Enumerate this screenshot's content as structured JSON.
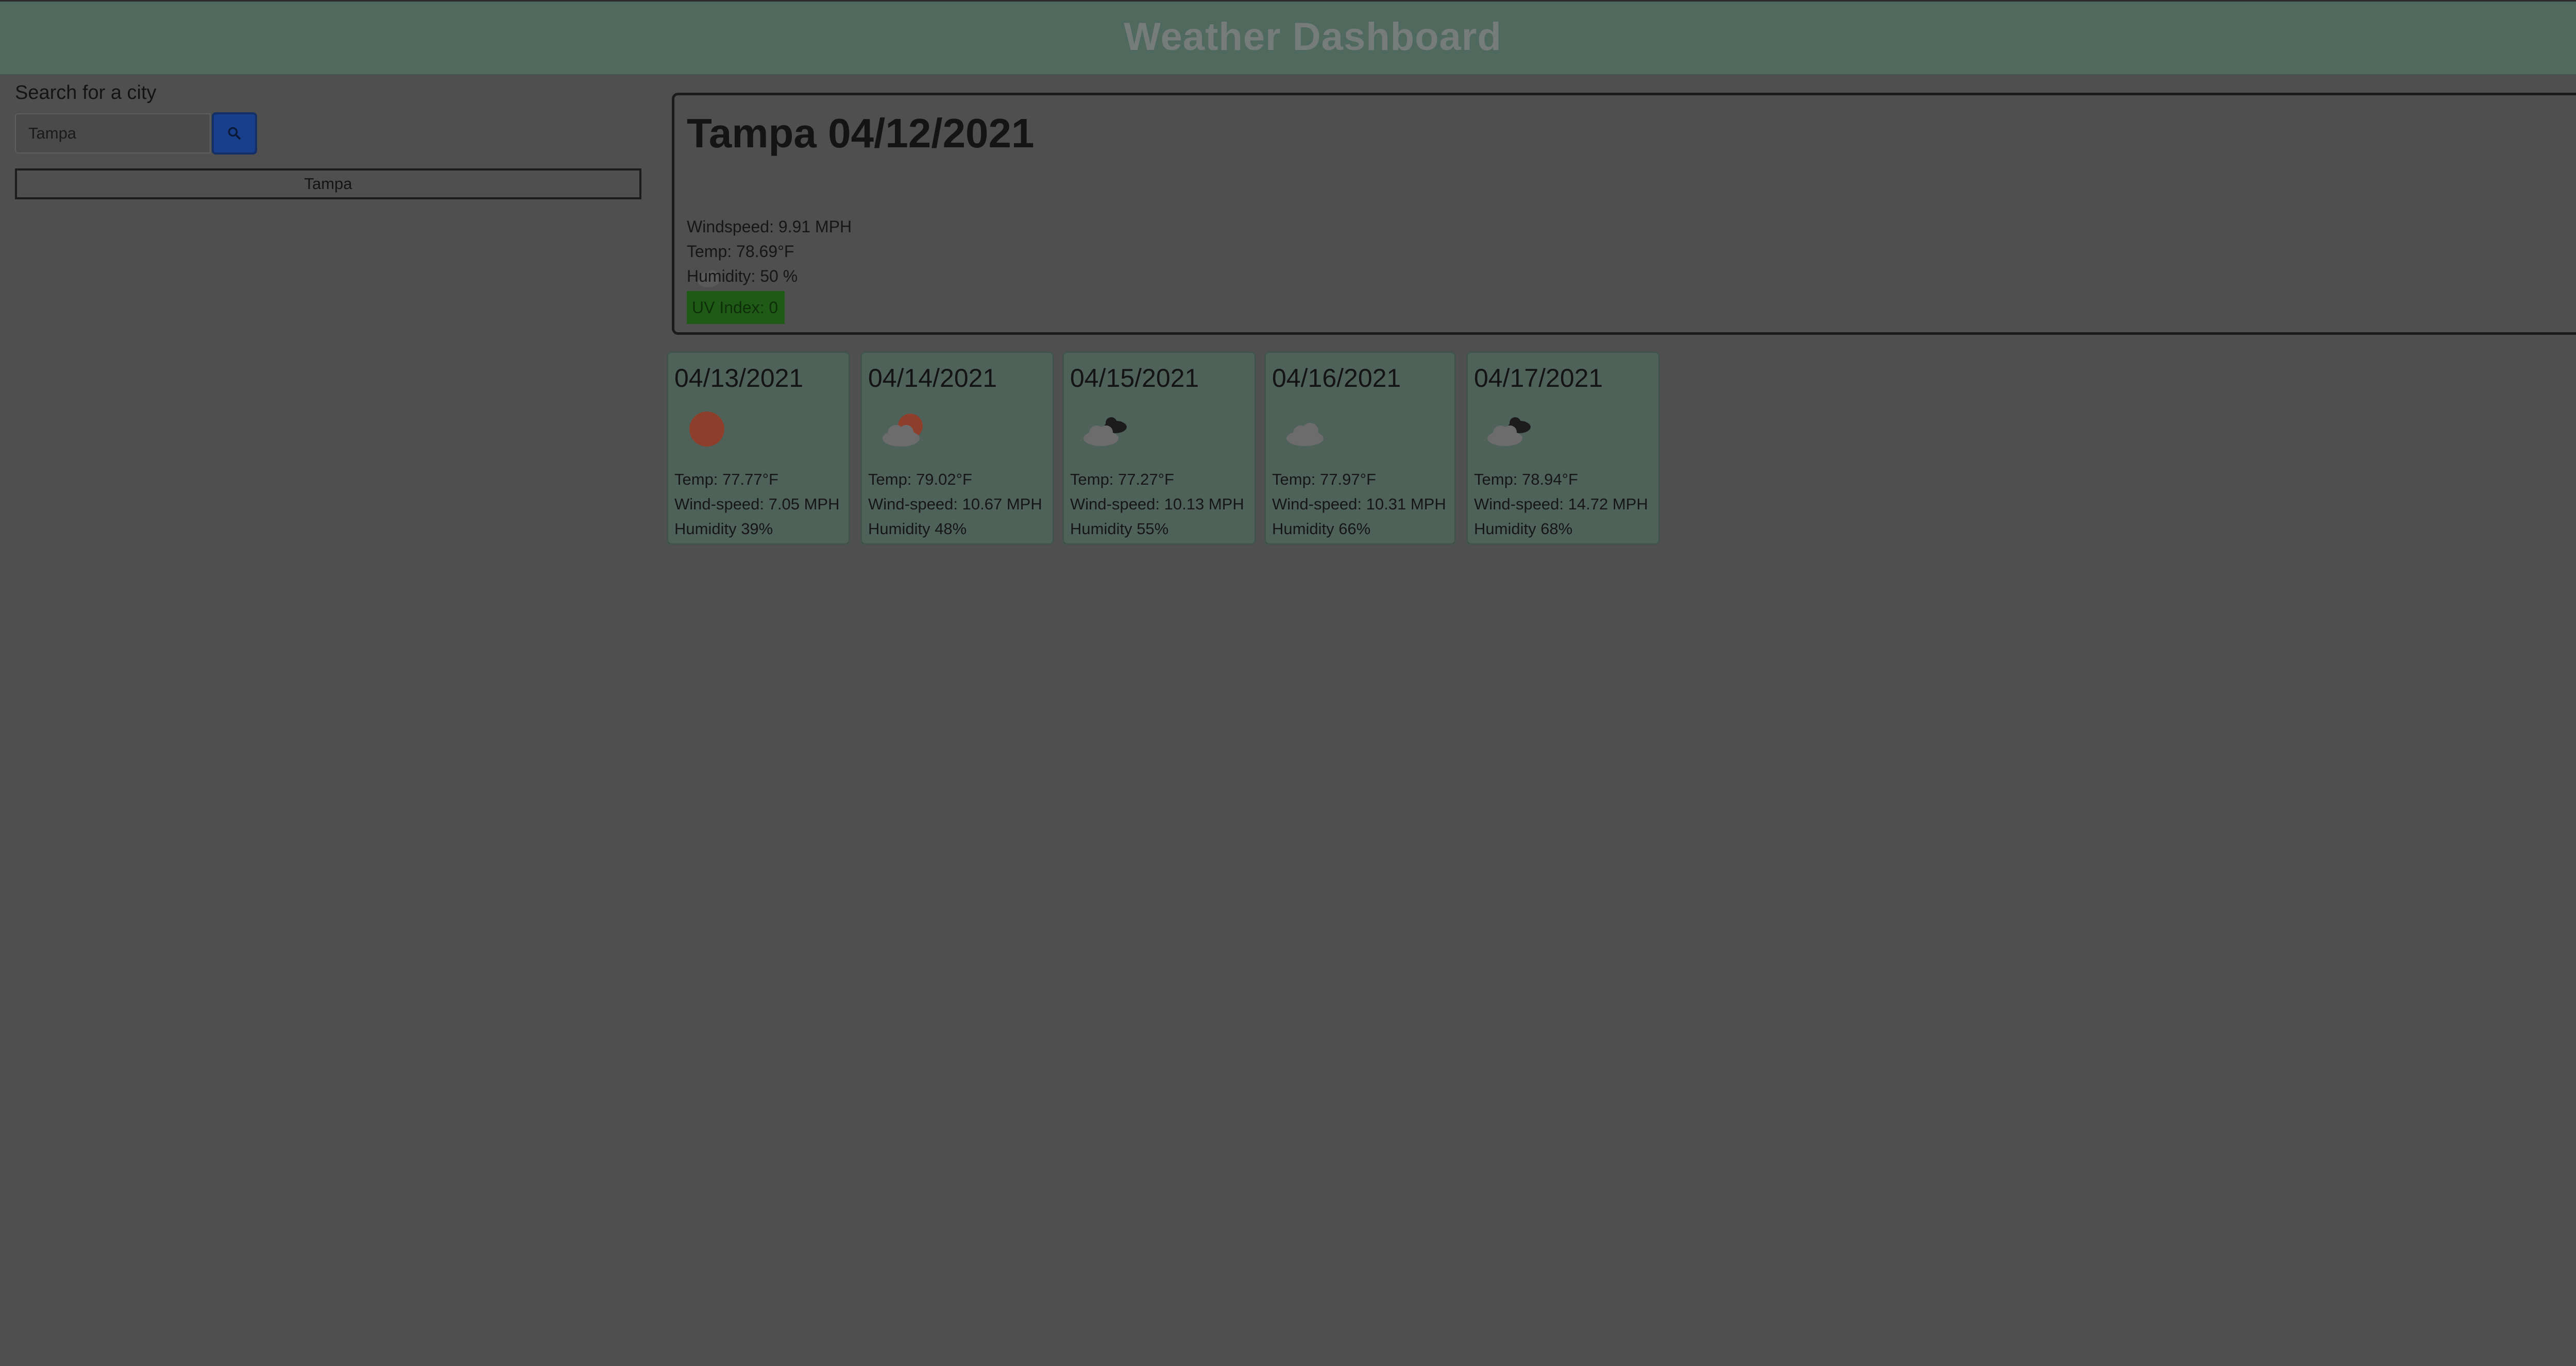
{
  "header": {
    "title": "Weather Dashboard"
  },
  "sidebar": {
    "search_label": "Search for a city",
    "search_input": {
      "value": "Tampa",
      "placeholder": "Tampa"
    },
    "search_button_icon": "search-icon",
    "history": [
      "Tampa"
    ]
  },
  "current": {
    "heading": "Tampa 04/12/2021",
    "icon": "few-clouds-icon",
    "windspeed": "Windspeed: 9.91 MPH",
    "temp": "Temp: 78.69°F",
    "humidity": "Humidity: 50 %",
    "uv": "UV Index: 0",
    "uv_color": "#1f5b16"
  },
  "forecast": [
    {
      "date": "04/13/2021",
      "icon": "sun-icon",
      "temp": "Temp: 77.77°F",
      "wind": "Wind-speed: 7.05 MPH",
      "humidity": "Humidity 39%"
    },
    {
      "date": "04/14/2021",
      "icon": "sun-behind-cloud-icon",
      "temp": "Temp: 79.02°F",
      "wind": "Wind-speed: 10.67 MPH",
      "humidity": "Humidity 48%"
    },
    {
      "date": "04/15/2021",
      "icon": "broken-clouds-icon",
      "temp": "Temp: 77.27°F",
      "wind": "Wind-speed: 10.13 MPH",
      "humidity": "Humidity 55%"
    },
    {
      "date": "04/16/2021",
      "icon": "cloud-icon",
      "temp": "Temp: 77.97°F",
      "wind": "Wind-speed: 10.31 MPH",
      "humidity": "Humidity 66%"
    },
    {
      "date": "04/17/2021",
      "icon": "broken-clouds-icon",
      "temp": "Temp: 78.94°F",
      "wind": "Wind-speed: 14.72 MPH",
      "humidity": "Humidity 68%"
    }
  ],
  "colors": {
    "header_bg": "#50695f",
    "page_bg": "#4f4f4f",
    "forecast_bg": "#4e6259",
    "search_button_bg": "#183f8c",
    "uv_badge_bg": "#1f5b16"
  }
}
